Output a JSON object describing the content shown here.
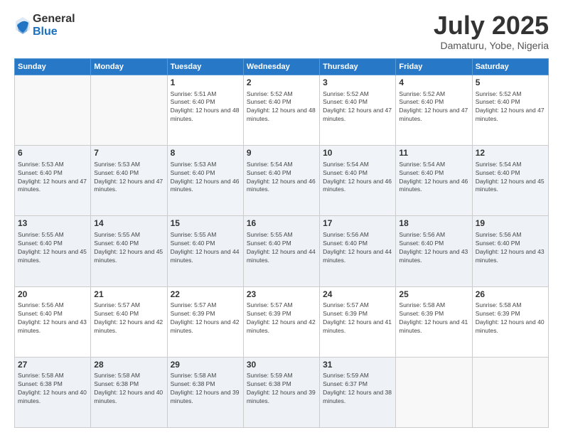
{
  "header": {
    "logo_general": "General",
    "logo_blue": "Blue",
    "month_title": "July 2025",
    "location": "Damaturu, Yobe, Nigeria"
  },
  "days_of_week": [
    "Sunday",
    "Monday",
    "Tuesday",
    "Wednesday",
    "Thursday",
    "Friday",
    "Saturday"
  ],
  "weeks": [
    [
      {
        "day": "",
        "info": ""
      },
      {
        "day": "",
        "info": ""
      },
      {
        "day": "1",
        "info": "Sunrise: 5:51 AM\nSunset: 6:40 PM\nDaylight: 12 hours and 48 minutes."
      },
      {
        "day": "2",
        "info": "Sunrise: 5:52 AM\nSunset: 6:40 PM\nDaylight: 12 hours and 48 minutes."
      },
      {
        "day": "3",
        "info": "Sunrise: 5:52 AM\nSunset: 6:40 PM\nDaylight: 12 hours and 47 minutes."
      },
      {
        "day": "4",
        "info": "Sunrise: 5:52 AM\nSunset: 6:40 PM\nDaylight: 12 hours and 47 minutes."
      },
      {
        "day": "5",
        "info": "Sunrise: 5:52 AM\nSunset: 6:40 PM\nDaylight: 12 hours and 47 minutes."
      }
    ],
    [
      {
        "day": "6",
        "info": "Sunrise: 5:53 AM\nSunset: 6:40 PM\nDaylight: 12 hours and 47 minutes."
      },
      {
        "day": "7",
        "info": "Sunrise: 5:53 AM\nSunset: 6:40 PM\nDaylight: 12 hours and 47 minutes."
      },
      {
        "day": "8",
        "info": "Sunrise: 5:53 AM\nSunset: 6:40 PM\nDaylight: 12 hours and 46 minutes."
      },
      {
        "day": "9",
        "info": "Sunrise: 5:54 AM\nSunset: 6:40 PM\nDaylight: 12 hours and 46 minutes."
      },
      {
        "day": "10",
        "info": "Sunrise: 5:54 AM\nSunset: 6:40 PM\nDaylight: 12 hours and 46 minutes."
      },
      {
        "day": "11",
        "info": "Sunrise: 5:54 AM\nSunset: 6:40 PM\nDaylight: 12 hours and 46 minutes."
      },
      {
        "day": "12",
        "info": "Sunrise: 5:54 AM\nSunset: 6:40 PM\nDaylight: 12 hours and 45 minutes."
      }
    ],
    [
      {
        "day": "13",
        "info": "Sunrise: 5:55 AM\nSunset: 6:40 PM\nDaylight: 12 hours and 45 minutes."
      },
      {
        "day": "14",
        "info": "Sunrise: 5:55 AM\nSunset: 6:40 PM\nDaylight: 12 hours and 45 minutes."
      },
      {
        "day": "15",
        "info": "Sunrise: 5:55 AM\nSunset: 6:40 PM\nDaylight: 12 hours and 44 minutes."
      },
      {
        "day": "16",
        "info": "Sunrise: 5:55 AM\nSunset: 6:40 PM\nDaylight: 12 hours and 44 minutes."
      },
      {
        "day": "17",
        "info": "Sunrise: 5:56 AM\nSunset: 6:40 PM\nDaylight: 12 hours and 44 minutes."
      },
      {
        "day": "18",
        "info": "Sunrise: 5:56 AM\nSunset: 6:40 PM\nDaylight: 12 hours and 43 minutes."
      },
      {
        "day": "19",
        "info": "Sunrise: 5:56 AM\nSunset: 6:40 PM\nDaylight: 12 hours and 43 minutes."
      }
    ],
    [
      {
        "day": "20",
        "info": "Sunrise: 5:56 AM\nSunset: 6:40 PM\nDaylight: 12 hours and 43 minutes."
      },
      {
        "day": "21",
        "info": "Sunrise: 5:57 AM\nSunset: 6:40 PM\nDaylight: 12 hours and 42 minutes."
      },
      {
        "day": "22",
        "info": "Sunrise: 5:57 AM\nSunset: 6:39 PM\nDaylight: 12 hours and 42 minutes."
      },
      {
        "day": "23",
        "info": "Sunrise: 5:57 AM\nSunset: 6:39 PM\nDaylight: 12 hours and 42 minutes."
      },
      {
        "day": "24",
        "info": "Sunrise: 5:57 AM\nSunset: 6:39 PM\nDaylight: 12 hours and 41 minutes."
      },
      {
        "day": "25",
        "info": "Sunrise: 5:58 AM\nSunset: 6:39 PM\nDaylight: 12 hours and 41 minutes."
      },
      {
        "day": "26",
        "info": "Sunrise: 5:58 AM\nSunset: 6:39 PM\nDaylight: 12 hours and 40 minutes."
      }
    ],
    [
      {
        "day": "27",
        "info": "Sunrise: 5:58 AM\nSunset: 6:38 PM\nDaylight: 12 hours and 40 minutes."
      },
      {
        "day": "28",
        "info": "Sunrise: 5:58 AM\nSunset: 6:38 PM\nDaylight: 12 hours and 40 minutes."
      },
      {
        "day": "29",
        "info": "Sunrise: 5:58 AM\nSunset: 6:38 PM\nDaylight: 12 hours and 39 minutes."
      },
      {
        "day": "30",
        "info": "Sunrise: 5:59 AM\nSunset: 6:38 PM\nDaylight: 12 hours and 39 minutes."
      },
      {
        "day": "31",
        "info": "Sunrise: 5:59 AM\nSunset: 6:37 PM\nDaylight: 12 hours and 38 minutes."
      },
      {
        "day": "",
        "info": ""
      },
      {
        "day": "",
        "info": ""
      }
    ]
  ]
}
